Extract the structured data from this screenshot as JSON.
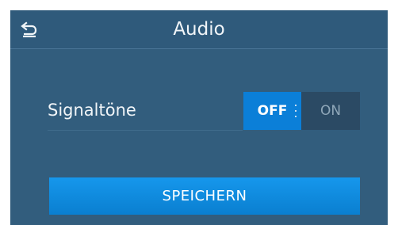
{
  "header": {
    "title": "Audio",
    "back_icon": "back-arrow-icon"
  },
  "settings": {
    "signal_tones": {
      "label": "Signaltöne",
      "toggle": {
        "off_label": "OFF",
        "on_label": "ON",
        "selected": "OFF"
      }
    }
  },
  "actions": {
    "save_label": "SPEICHERN"
  },
  "colors": {
    "background": "#325d7d",
    "header": "#2f5a7b",
    "accent": "#0b7fd8",
    "text": "#f1f5f8",
    "inactive_text": "#8fa7b9"
  }
}
